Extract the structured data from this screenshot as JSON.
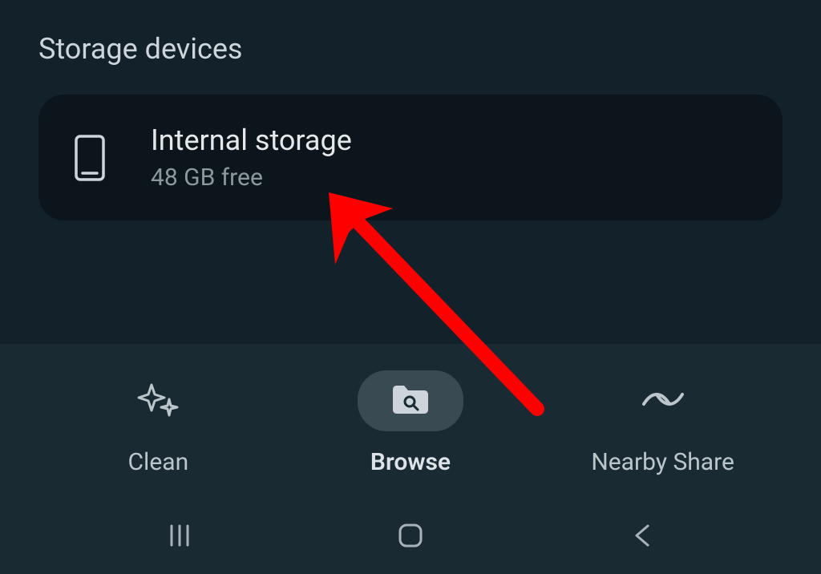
{
  "section": {
    "title": "Storage devices"
  },
  "storage": {
    "title": "Internal storage",
    "subtitle": "48 GB free"
  },
  "tabs": {
    "clean": {
      "label": "Clean"
    },
    "browse": {
      "label": "Browse"
    },
    "nearby_share": {
      "label": "Nearby Share"
    }
  },
  "annotation": {
    "arrow_color": "#ff0000"
  }
}
